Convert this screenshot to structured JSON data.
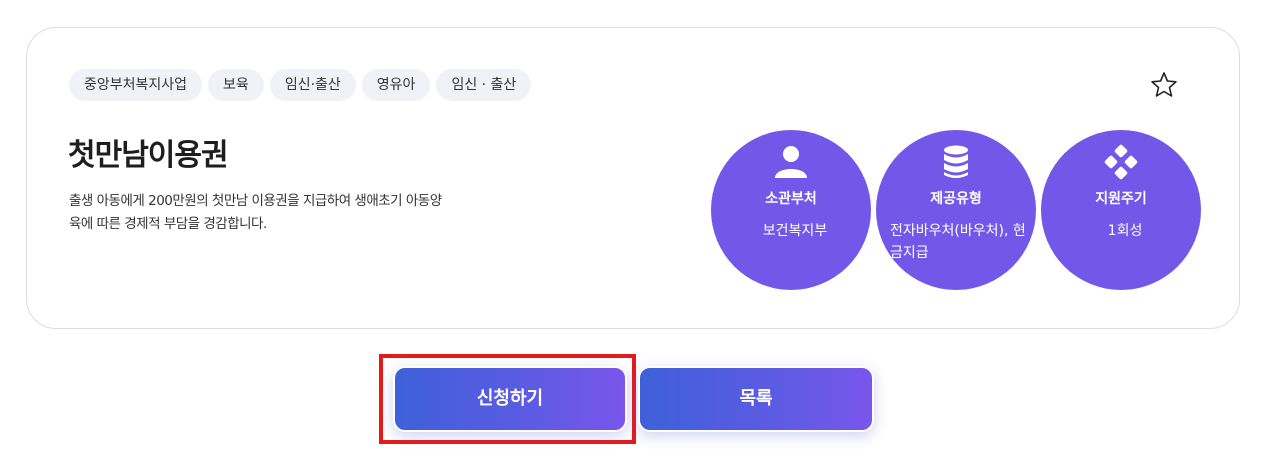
{
  "card": {
    "tags": [
      "중앙부처복지사업",
      "보육",
      "임신·출산",
      "영유아",
      "임신 · 출산"
    ],
    "title": "첫만남이용권",
    "description": "출생 아동에게 200만원의 첫만남 이용권을 지급하여 생애초기 아동양육에 따른 경제적 부담을 경감합니다.",
    "info": [
      {
        "icon": "person-icon",
        "label": "소관부처",
        "value": "보건복지부"
      },
      {
        "icon": "database-icon",
        "label": "제공유형",
        "value": "전자바우처(바우처), 현금지급"
      },
      {
        "icon": "diamond-dots-icon",
        "label": "지원주기",
        "value": "1회성"
      }
    ]
  },
  "actions": {
    "apply_label": "신청하기",
    "list_label": "목록"
  },
  "colors": {
    "circle": "#7258e8",
    "button_start": "#3f60d9",
    "button_end": "#7a56ec",
    "highlight": "#e51b1b",
    "tag_bg": "#f1f1f8"
  }
}
